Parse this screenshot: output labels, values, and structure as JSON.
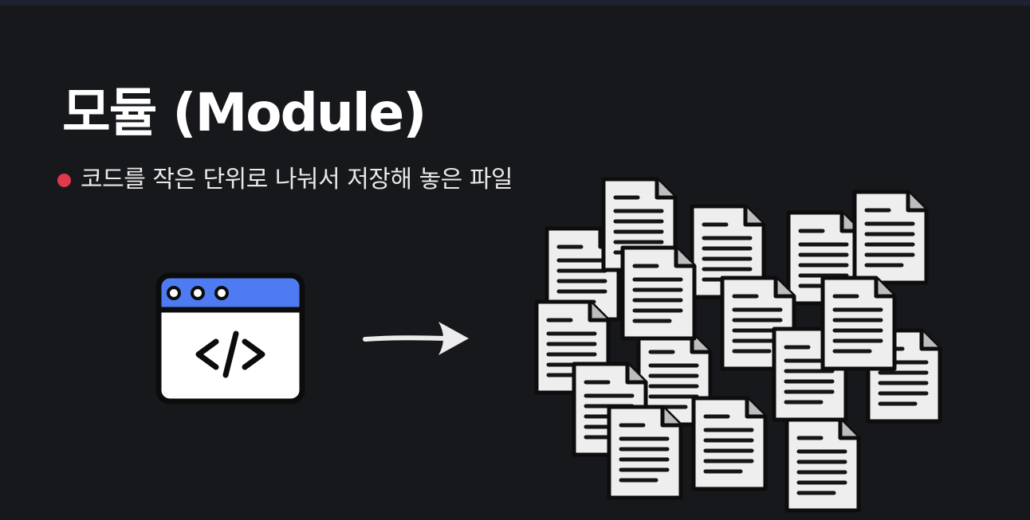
{
  "slide": {
    "title": "모듈 (Module)",
    "bullet": "코드를 작은 단위로 나눠서 저장해 놓은 파일"
  },
  "icons": {
    "window": "code-window-icon",
    "arrow": "arrow-right-icon",
    "file": "document-file-icon"
  },
  "colors": {
    "background": "#17181b",
    "window_header": "#4e7bf2",
    "bullet": "#e0394b",
    "file_fill": "#eeeeee",
    "file_lines": "#1a1a1a"
  }
}
